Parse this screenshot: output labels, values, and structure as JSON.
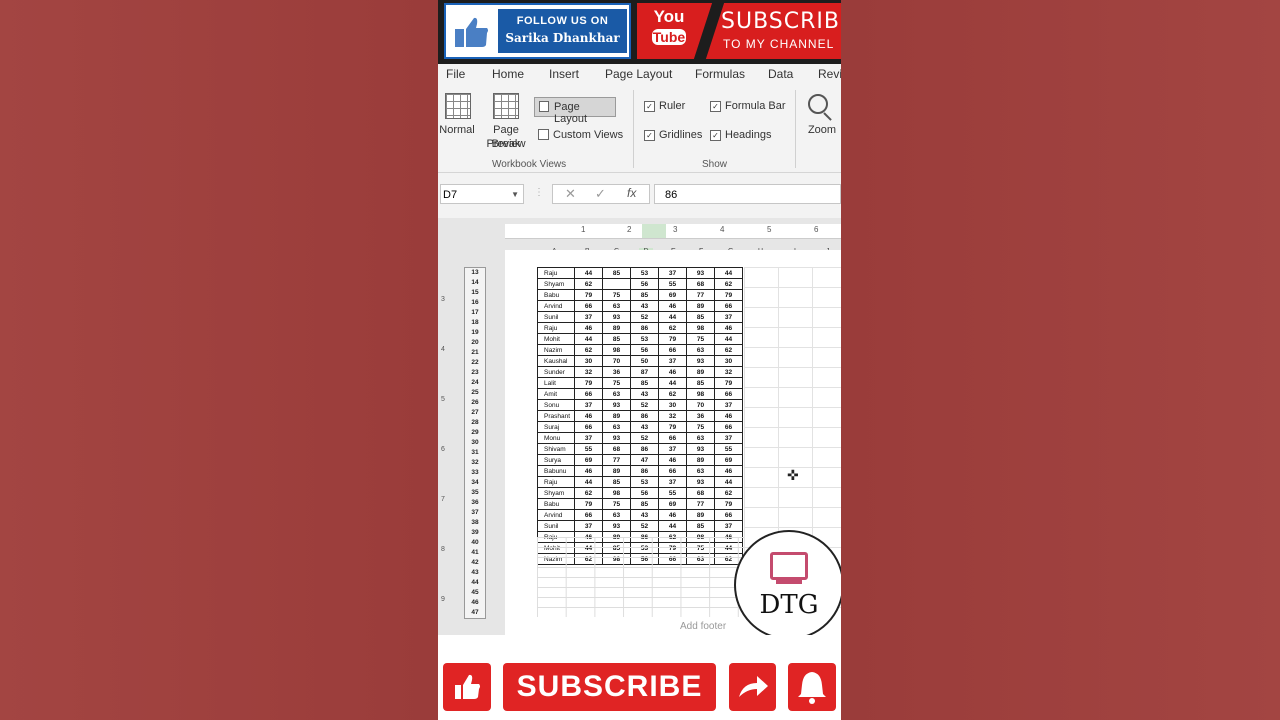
{
  "banner": {
    "follow_line1": "FOLLOW US ON",
    "follow_line2": "Sarika Dhankhar",
    "yt_you": "You",
    "yt_tube": "Tube",
    "subscribe": "SUBSCRIBE",
    "to_channel": "TO MY CHANNEL"
  },
  "ribbon": {
    "tabs": [
      "File",
      "Home",
      "Insert",
      "Page Layout",
      "Formulas",
      "Data",
      "Revi"
    ],
    "normal": "Normal",
    "page_break_line1": "Page Break",
    "page_break_line2": "Preview",
    "page_layout": "Page Layout",
    "custom_views": "Custom Views",
    "workbook_views": "Workbook Views",
    "ruler": "Ruler",
    "formula_bar": "Formula Bar",
    "gridlines": "Gridlines",
    "headings": "Headings",
    "show": "Show",
    "zoom": "Zoom",
    "check_mark": "✓"
  },
  "formula_bar": {
    "name_box": "D7",
    "cancel": "✕",
    "enter": "✓",
    "fx": "fx",
    "value": "86"
  },
  "sheet": {
    "column_headers": [
      "A",
      "B",
      "C",
      "D",
      "E",
      "F",
      "G",
      "H",
      "I",
      "J"
    ],
    "ruler_numbers": [
      "1",
      "2",
      "3",
      "4",
      "5",
      "6"
    ],
    "vertical_ruler_numbers": [
      "3",
      "4",
      "5",
      "6",
      "7",
      "8",
      "9"
    ],
    "row_numbers": [
      "13",
      "14",
      "15",
      "16",
      "17",
      "18",
      "19",
      "20",
      "21",
      "22",
      "23",
      "24",
      "25",
      "26",
      "27",
      "28",
      "29",
      "30",
      "31",
      "32",
      "33",
      "34",
      "35",
      "36",
      "37",
      "38",
      "39",
      "40",
      "41",
      "42",
      "43",
      "44",
      "45",
      "46",
      "47"
    ],
    "add_footer": "Add footer",
    "rows": [
      [
        "Raju",
        "44",
        "85",
        "53",
        "37",
        "93",
        "44"
      ],
      [
        "Shyam",
        "62",
        "",
        "56",
        "55",
        "68",
        "62"
      ],
      [
        "Babu",
        "79",
        "75",
        "85",
        "69",
        "77",
        "79"
      ],
      [
        "Arvind",
        "66",
        "63",
        "43",
        "46",
        "89",
        "66"
      ],
      [
        "Sunil",
        "37",
        "93",
        "52",
        "44",
        "85",
        "37"
      ],
      [
        "Raju",
        "46",
        "89",
        "86",
        "62",
        "98",
        "46"
      ],
      [
        "Mohit",
        "44",
        "85",
        "53",
        "79",
        "75",
        "44"
      ],
      [
        "Nazim",
        "62",
        "98",
        "56",
        "66",
        "63",
        "62"
      ],
      [
        "Kaushal",
        "30",
        "70",
        "50",
        "37",
        "93",
        "30"
      ],
      [
        "Sunder",
        "32",
        "36",
        "87",
        "46",
        "89",
        "32"
      ],
      [
        "Lalit",
        "79",
        "75",
        "85",
        "44",
        "85",
        "79"
      ],
      [
        "Amit",
        "66",
        "63",
        "43",
        "62",
        "98",
        "66"
      ],
      [
        "Sonu",
        "37",
        "93",
        "52",
        "30",
        "70",
        "37"
      ],
      [
        "Prashant",
        "46",
        "89",
        "86",
        "32",
        "36",
        "46"
      ],
      [
        "Suraj",
        "66",
        "63",
        "43",
        "79",
        "75",
        "66"
      ],
      [
        "Monu",
        "37",
        "93",
        "52",
        "66",
        "63",
        "37"
      ],
      [
        "Shivam",
        "55",
        "68",
        "86",
        "37",
        "93",
        "55"
      ],
      [
        "Surya",
        "69",
        "77",
        "47",
        "46",
        "89",
        "69"
      ],
      [
        "Babunu",
        "46",
        "89",
        "86",
        "66",
        "63",
        "46"
      ],
      [
        "Raju",
        "44",
        "85",
        "53",
        "37",
        "93",
        "44"
      ],
      [
        "Shyam",
        "62",
        "98",
        "56",
        "55",
        "68",
        "62"
      ],
      [
        "Babu",
        "79",
        "75",
        "85",
        "69",
        "77",
        "79"
      ],
      [
        "Arvind",
        "66",
        "63",
        "43",
        "46",
        "89",
        "66"
      ],
      [
        "Sunil",
        "37",
        "93",
        "52",
        "44",
        "85",
        "37"
      ],
      [
        "Raju",
        "46",
        "89",
        "86",
        "62",
        "98",
        "46"
      ],
      [
        "Mohit",
        "44",
        "85",
        "53",
        "79",
        "75",
        "44"
      ],
      [
        "Nazim",
        "62",
        "98",
        "56",
        "66",
        "63",
        "62"
      ]
    ]
  },
  "watermark": {
    "text": "DTG"
  },
  "bottom": {
    "subscribe": "SUBSCRIBE"
  }
}
